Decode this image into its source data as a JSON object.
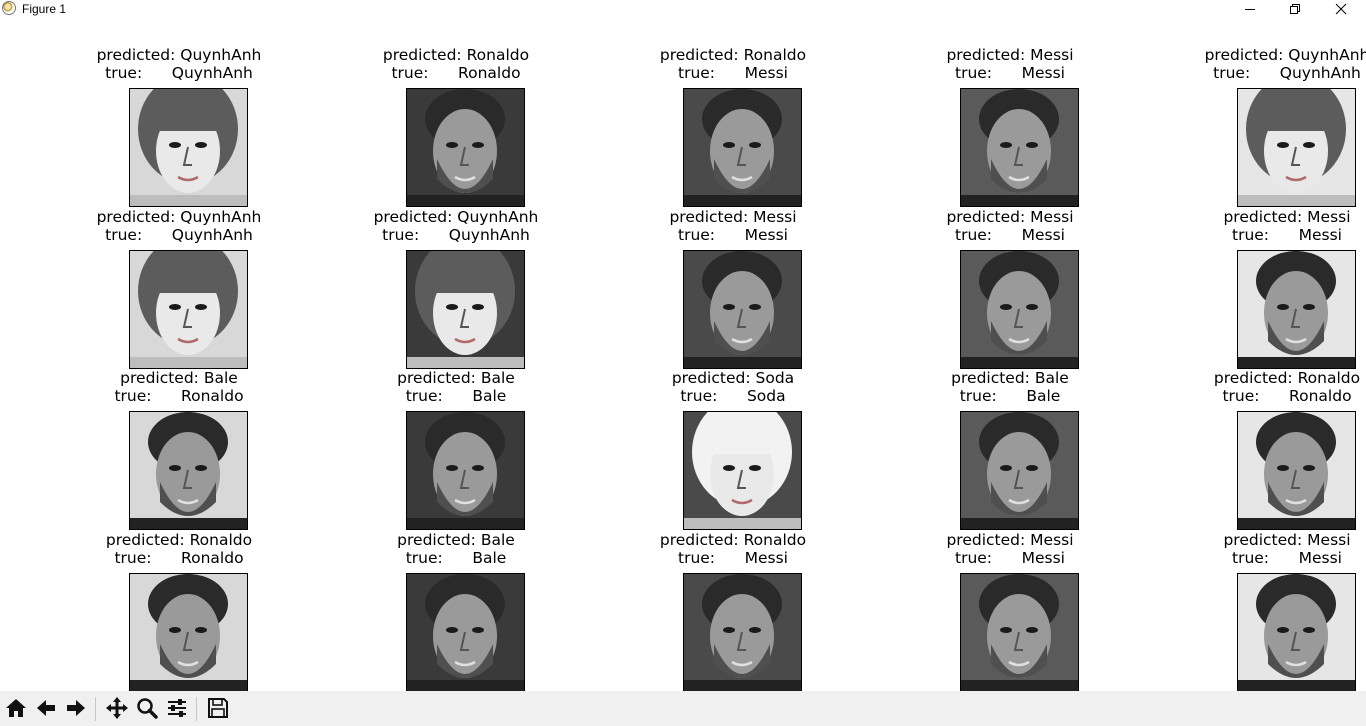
{
  "window": {
    "title": "Figure 1",
    "icons": [
      "figure-app-icon",
      "minimize-icon",
      "restore-icon",
      "close-icon"
    ]
  },
  "figure": {
    "true_prefix": "true:",
    "pred_prefix": "predicted:",
    "cells": [
      {
        "predicted": "QuynhAnh",
        "true": "QuynhAnh",
        "kind": "f"
      },
      {
        "predicted": "Ronaldo",
        "true": "Ronaldo",
        "kind": "m"
      },
      {
        "predicted": "Ronaldo",
        "true": "Messi",
        "kind": "m"
      },
      {
        "predicted": "Messi",
        "true": "Messi",
        "kind": "m"
      },
      {
        "predicted": "QuynhAnh",
        "true": "QuynhAnh",
        "kind": "f"
      },
      {
        "predicted": "QuynhAnh",
        "true": "QuynhAnh",
        "kind": "f"
      },
      {
        "predicted": "QuynhAnh",
        "true": "QuynhAnh",
        "kind": "f"
      },
      {
        "predicted": "Messi",
        "true": "Messi",
        "kind": "m"
      },
      {
        "predicted": "Messi",
        "true": "Messi",
        "kind": "m"
      },
      {
        "predicted": "Messi",
        "true": "Messi",
        "kind": "m"
      },
      {
        "predicted": "Bale",
        "true": "Ronaldo",
        "kind": "m"
      },
      {
        "predicted": "Bale",
        "true": "Bale",
        "kind": "m"
      },
      {
        "predicted": "Soda",
        "true": "Soda",
        "kind": "f"
      },
      {
        "predicted": "Bale",
        "true": "Bale",
        "kind": "m"
      },
      {
        "predicted": "Ronaldo",
        "true": "Ronaldo",
        "kind": "m"
      },
      {
        "predicted": "Ronaldo",
        "true": "Ronaldo",
        "kind": "m"
      },
      {
        "predicted": "Bale",
        "true": "Bale",
        "kind": "m"
      },
      {
        "predicted": "Ronaldo",
        "true": "Messi",
        "kind": "m"
      },
      {
        "predicted": "Messi",
        "true": "Messi",
        "kind": "m"
      },
      {
        "predicted": "Messi",
        "true": "Messi",
        "kind": "m"
      }
    ]
  },
  "toolbar": {
    "buttons": [
      "home-icon",
      "back-icon",
      "forward-icon",
      "pan-icon",
      "zoom-icon",
      "subplots-icon",
      "save-icon"
    ]
  }
}
